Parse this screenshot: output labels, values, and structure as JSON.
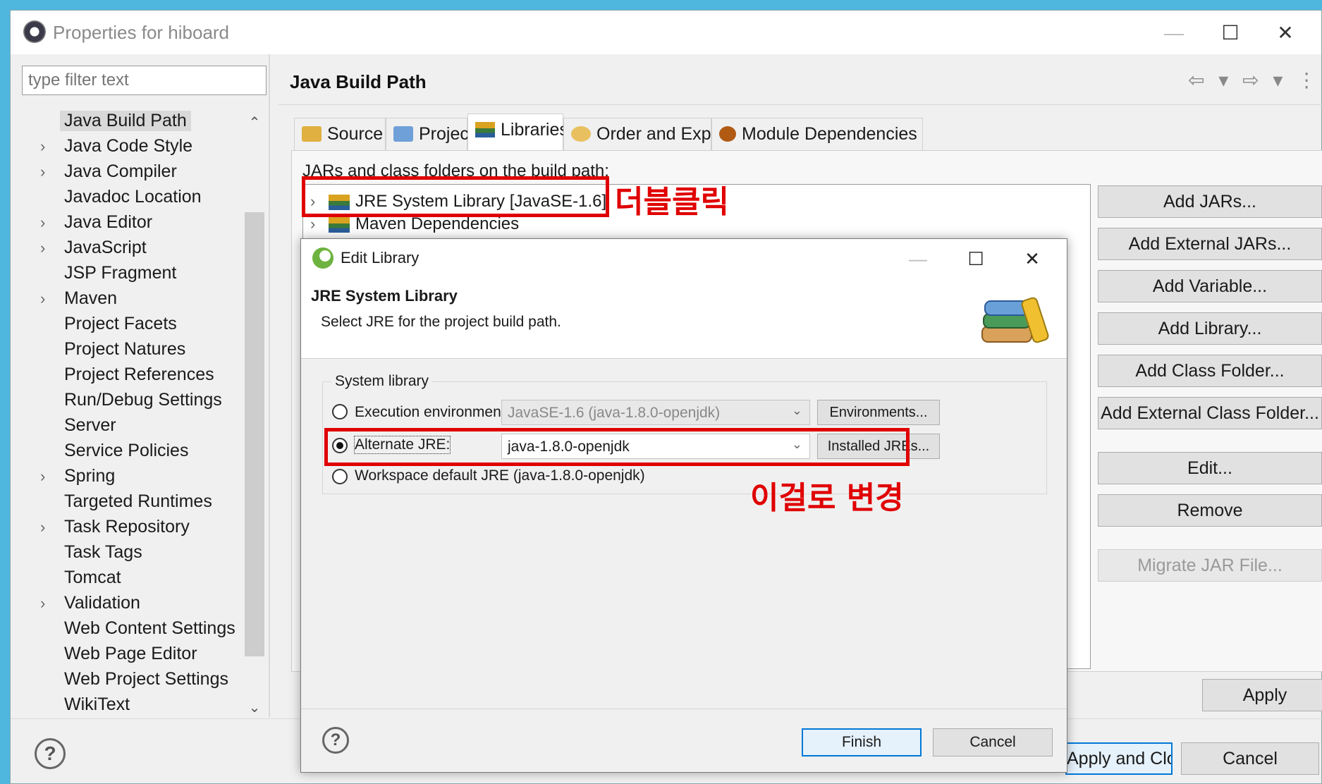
{
  "window": {
    "title": "Properties for hiboard",
    "min": "—",
    "max": "☐",
    "close": "✕"
  },
  "filter": {
    "placeholder": "type filter text"
  },
  "tree": {
    "items": [
      {
        "label": "Java Build Path",
        "expandable": false
      },
      {
        "label": "Java Code Style",
        "expandable": true
      },
      {
        "label": "Java Compiler",
        "expandable": true
      },
      {
        "label": "Javadoc Location",
        "expandable": false
      },
      {
        "label": "Java Editor",
        "expandable": true
      },
      {
        "label": "JavaScript",
        "expandable": true
      },
      {
        "label": "JSP Fragment",
        "expandable": false
      },
      {
        "label": "Maven",
        "expandable": true
      },
      {
        "label": "Project Facets",
        "expandable": false
      },
      {
        "label": "Project Natures",
        "expandable": false
      },
      {
        "label": "Project References",
        "expandable": false
      },
      {
        "label": "Run/Debug Settings",
        "expandable": false
      },
      {
        "label": "Server",
        "expandable": false
      },
      {
        "label": "Service Policies",
        "expandable": false
      },
      {
        "label": "Spring",
        "expandable": true
      },
      {
        "label": "Targeted Runtimes",
        "expandable": false
      },
      {
        "label": "Task Repository",
        "expandable": true
      },
      {
        "label": "Task Tags",
        "expandable": false
      },
      {
        "label": "Tomcat",
        "expandable": false
      },
      {
        "label": "Validation",
        "expandable": true
      },
      {
        "label": "Web Content Settings",
        "expandable": false
      },
      {
        "label": "Web Page Editor",
        "expandable": false
      },
      {
        "label": "Web Project Settings",
        "expandable": false
      },
      {
        "label": "WikiText",
        "expandable": false
      }
    ],
    "selected": 0
  },
  "page": {
    "title": "Java Build Path",
    "nav_icons": "⇦ ▾ ⇨ ▾ ⋮"
  },
  "tabs": [
    {
      "label": "Source"
    },
    {
      "label": "Projects"
    },
    {
      "label": "Libraries"
    },
    {
      "label": "Order and Export"
    },
    {
      "label": "Module Dependencies"
    }
  ],
  "libraries": {
    "caption": "JARs and class folders on the build path:",
    "rows": [
      {
        "label": "JRE System Library [JavaSE-1.6]"
      },
      {
        "label": "Maven Dependencies"
      }
    ]
  },
  "side_buttons": [
    {
      "label": "Add JARs...",
      "enabled": true
    },
    {
      "label": "Add External JARs...",
      "enabled": true
    },
    {
      "label": "Add Variable...",
      "enabled": true
    },
    {
      "label": "Add Library...",
      "enabled": true
    },
    {
      "label": "Add Class Folder...",
      "enabled": true
    },
    {
      "label": "Add External Class Folder...",
      "enabled": true
    },
    {
      "label": "Edit...",
      "enabled": true
    },
    {
      "label": "Remove",
      "enabled": true
    },
    {
      "label": "Migrate JAR File...",
      "enabled": false
    }
  ],
  "footer": {
    "apply": "Apply",
    "apply_close": "Apply and Close",
    "cancel": "Cancel",
    "help": "?"
  },
  "annotations": {
    "double_click": "더블클릭",
    "change_to_this": "이걸로 변경"
  },
  "dialog": {
    "title": "Edit Library",
    "min": "—",
    "max": "☐",
    "close": "✕",
    "header_title": "JRE System Library",
    "header_desc": "Select JRE for the project build path.",
    "group_label": "System library",
    "options": {
      "execution_env": "Execution environment:",
      "alternate_jre": "Alternate JRE:",
      "workspace_default": "Workspace default JRE (java-1.8.0-openjdk)"
    },
    "execution_env_value": "JavaSE-1.6 (java-1.8.0-openjdk)",
    "alternate_jre_value": "java-1.8.0-openjdk",
    "selected_option": "alternate_jre",
    "environments_btn": "Environments...",
    "installed_jres_btn": "Installed JREs...",
    "finish": "Finish",
    "cancel": "Cancel",
    "help": "?"
  },
  "colors": {
    "annotation_red": "#e00000",
    "focus_blue": "#0078d7",
    "desktop": "#4fb6de"
  }
}
